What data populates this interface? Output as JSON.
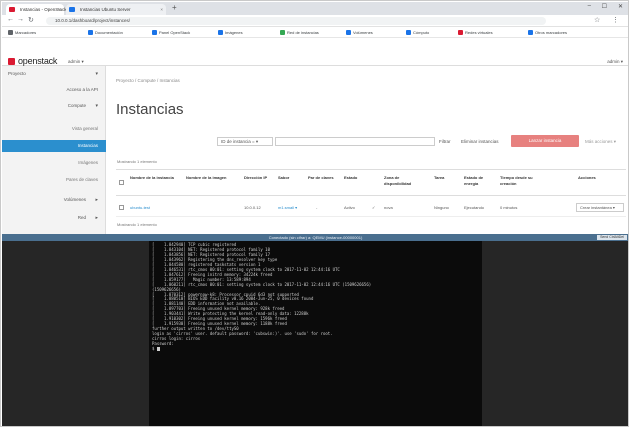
{
  "browser": {
    "tabs": [
      {
        "label": "Instancias - OpenStack D...",
        "favicon_color": "#da1a32"
      },
      {
        "label": "Instancias Ubuntu Server",
        "favicon_color": "#1a73e8"
      }
    ],
    "new_tab_icon": "plus-icon",
    "url": "10.0.0.1/dashboard/project/instances/",
    "bookmarks": [
      {
        "label": "Marcadores",
        "color": "#5f6368"
      },
      {
        "label": "Documentación",
        "color": "#1a73e8"
      },
      {
        "label": "Panel OpenStack",
        "color": "#1a73e8"
      },
      {
        "label": "Imágenes",
        "color": "#1a73e8"
      },
      {
        "label": "Red de instancias",
        "color": "#34a853"
      },
      {
        "label": "Volúmenes",
        "color": "#1a73e8"
      },
      {
        "label": "Cómputo",
        "color": "#1a73e8"
      },
      {
        "label": "Redes virtuales",
        "color": "#da1a32"
      },
      {
        "label": "Otros marcadores",
        "color": "#1a73e8"
      }
    ]
  },
  "header": {
    "logo_text": "openstack",
    "project": "admin ▾",
    "user": "admin ▾"
  },
  "sidebar": {
    "items": [
      {
        "label": "Proyecto",
        "level": 1,
        "chevron": "▾"
      },
      {
        "label": "Acceso a la API",
        "level": 2
      },
      {
        "label": "Compute",
        "level": 2,
        "chevron": "▾"
      },
      {
        "label": "Vista general",
        "level": 3
      },
      {
        "label": "Instancias",
        "level": 3,
        "active": true
      },
      {
        "label": "Imágenes",
        "level": 3
      },
      {
        "label": "Pares de claves",
        "level": 3
      },
      {
        "label": "Volúmenes",
        "level": 2,
        "chevron": "▸"
      },
      {
        "label": "Red",
        "level": 2,
        "chevron": "▸"
      }
    ]
  },
  "main": {
    "breadcrumb": "Proyecto / Compute / Instancias",
    "title": "Instancias",
    "filter": {
      "select": "ID de instancia = ▾",
      "filter_button": "Filtrar",
      "launch_button": "Lanzar instancia",
      "delete_button": "Eliminar instancias",
      "more_button": "Más acciones ▾"
    },
    "count_top": "Mostrando 1 elemento",
    "count_bottom": "Mostrando 1 elemento",
    "columns": [
      "Nombre de la instancia",
      "Nombre de la imagen",
      "Dirección IP",
      "Sabor",
      "Par de claves",
      "Estado",
      "Zona de disponibilidad",
      "Tarea",
      "Estado de energía",
      "Tiempo desde su creación",
      "Acciones"
    ],
    "rows": [
      {
        "name": "ubuntu-test",
        "image": "",
        "ip": "10.0.0.12",
        "flavor": "m1.small ▾",
        "keypair": "-",
        "status": "Activo",
        "zone": "nova",
        "task": "Ninguno",
        "power": "Ejecutando",
        "age": "0 minutos",
        "action": "Crear instantánea ▾"
      }
    ]
  },
  "console": {
    "title": "Conectado (sin cifrar) a: QEMU (instance-00000001)",
    "button": "Send CtrlAltDel",
    "lines": [
      "[    1.842940] TCP cubic registered",
      "[    1.843104] NET: Registered protocol family 10",
      "[    1.843856] NET: Registered protocol family 17",
      "[    1.843962] Registering the dns_resolver key type",
      "[    1.844580] registered taskstats version 1",
      "[    1.846531] rtc_cmos 00:01: setting system clock to 2017-11-02 12:44:16 UTC",
      "[    1.847612] Freeing initrd memory: 34224k freed",
      "[    1.859177]   Magic number: 13:589:894",
      "[    1.860211] rtc_cmos 00:01: setting system clock to 2017-11-02 12:44:16 UTC (1509626656)",
      "(1509626656)",
      "[    1.870312] powernow-k8: Processor cpuid 6d3 not supported",
      "[    1.880510] BIOS EDD facility v0.16 2004-Jun-25, 0 devices found",
      "[    1.881140] EDD information not available.",
      "[    1.897703] Freeing unused kernel memory: 928k freed",
      "[    1.903441] Write protecting the kernel read-only data: 12288k",
      "[    1.910302] Freeing unused kernel memory: 1596k freed",
      "[    1.915930] Freeing unused kernel memory: 1188k freed",
      "",
      "further output written to /dev/ttyS0",
      "",
      "login as 'cirros' user. default password: 'cubswin:)'. use 'sudo' for root.",
      "cirros login: cirros",
      "Password:",
      "$ "
    ]
  }
}
